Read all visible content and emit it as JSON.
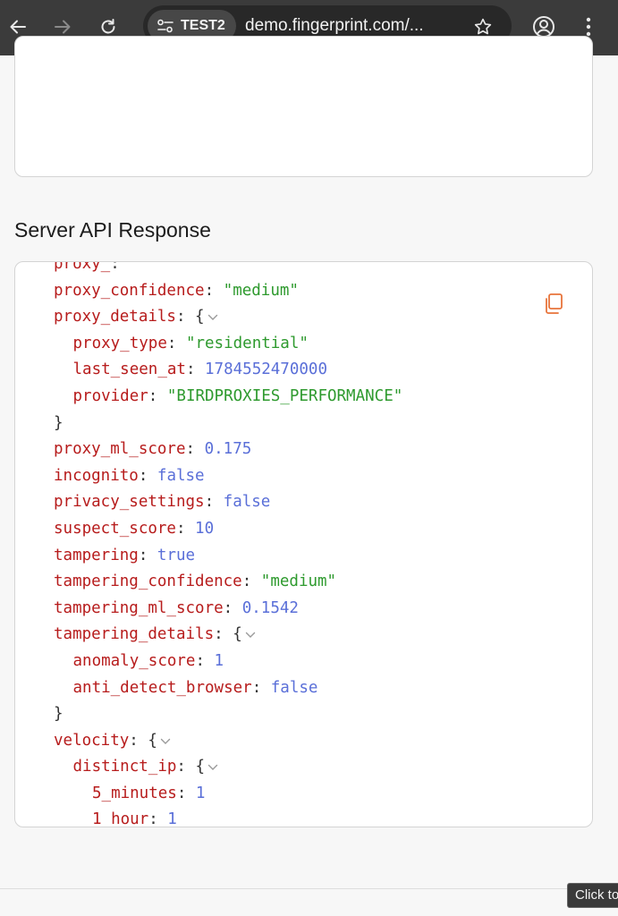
{
  "browser": {
    "site_chip": "TEST2",
    "url": "demo.fingerprint.com/...",
    "icons": [
      "back-arrow-icon",
      "forward-arrow-icon",
      "reload-icon",
      "site-settings-icon",
      "star-icon",
      "profile-icon",
      "more-vert-icon"
    ]
  },
  "page": {
    "section_title": "Server API Response",
    "tooltip": "Click to"
  },
  "code_lines": [
    {
      "indent": 2,
      "key": "proxy_",
      "sep": ":",
      "value": "",
      "kind": "p"
    },
    {
      "indent": 2,
      "key": "proxy_confidence",
      "sep": ": ",
      "value": "\"medium\"",
      "kind": "s"
    },
    {
      "indent": 2,
      "key": "proxy_details",
      "sep": ": ",
      "value": "{",
      "kind": "p",
      "chevron": true
    },
    {
      "indent": 3,
      "key": "proxy_type",
      "sep": ": ",
      "value": "\"residential\"",
      "kind": "s"
    },
    {
      "indent": 3,
      "key": "last_seen_at",
      "sep": ": ",
      "value": "1784552470000",
      "kind": "n"
    },
    {
      "indent": 3,
      "key": "provider",
      "sep": ": ",
      "value": "\"BIRDPROXIES_PERFORMANCE\"",
      "kind": "s"
    },
    {
      "indent": 2,
      "key": "",
      "sep": "",
      "value": "}",
      "kind": "p"
    },
    {
      "indent": 2,
      "key": "proxy_ml_score",
      "sep": ": ",
      "value": "0.175",
      "kind": "n"
    },
    {
      "indent": 2,
      "key": "incognito",
      "sep": ": ",
      "value": "false",
      "kind": "b"
    },
    {
      "indent": 2,
      "key": "privacy_settings",
      "sep": ": ",
      "value": "false",
      "kind": "b"
    },
    {
      "indent": 2,
      "key": "suspect_score",
      "sep": ": ",
      "value": "10",
      "kind": "n"
    },
    {
      "indent": 2,
      "key": "tampering",
      "sep": ": ",
      "value": "true",
      "kind": "b"
    },
    {
      "indent": 2,
      "key": "tampering_confidence",
      "sep": ": ",
      "value": "\"medium\"",
      "kind": "s"
    },
    {
      "indent": 2,
      "key": "tampering_ml_score",
      "sep": ": ",
      "value": "0.1542",
      "kind": "n"
    },
    {
      "indent": 2,
      "key": "tampering_details",
      "sep": ": ",
      "value": "{",
      "kind": "p",
      "chevron": true
    },
    {
      "indent": 3,
      "key": "anomaly_score",
      "sep": ": ",
      "value": "1",
      "kind": "n"
    },
    {
      "indent": 3,
      "key": "anti_detect_browser",
      "sep": ": ",
      "value": "false",
      "kind": "b"
    },
    {
      "indent": 2,
      "key": "",
      "sep": "",
      "value": "}",
      "kind": "p"
    },
    {
      "indent": 2,
      "key": "velocity",
      "sep": ": ",
      "value": "{",
      "kind": "p",
      "chevron": true
    },
    {
      "indent": 3,
      "key": "distinct_ip",
      "sep": ": ",
      "value": "{",
      "kind": "p",
      "chevron": true
    },
    {
      "indent": 4,
      "key": "5_minutes",
      "sep": ": ",
      "value": "1",
      "kind": "n"
    },
    {
      "indent": 4,
      "key": "1_hour",
      "sep": ": ",
      "value": "1",
      "kind": "n"
    }
  ],
  "colors": {
    "key": "#b71c1c",
    "string": "#2e9a2e",
    "number": "#5a6fd8",
    "copy_icon": "#e8743b"
  }
}
